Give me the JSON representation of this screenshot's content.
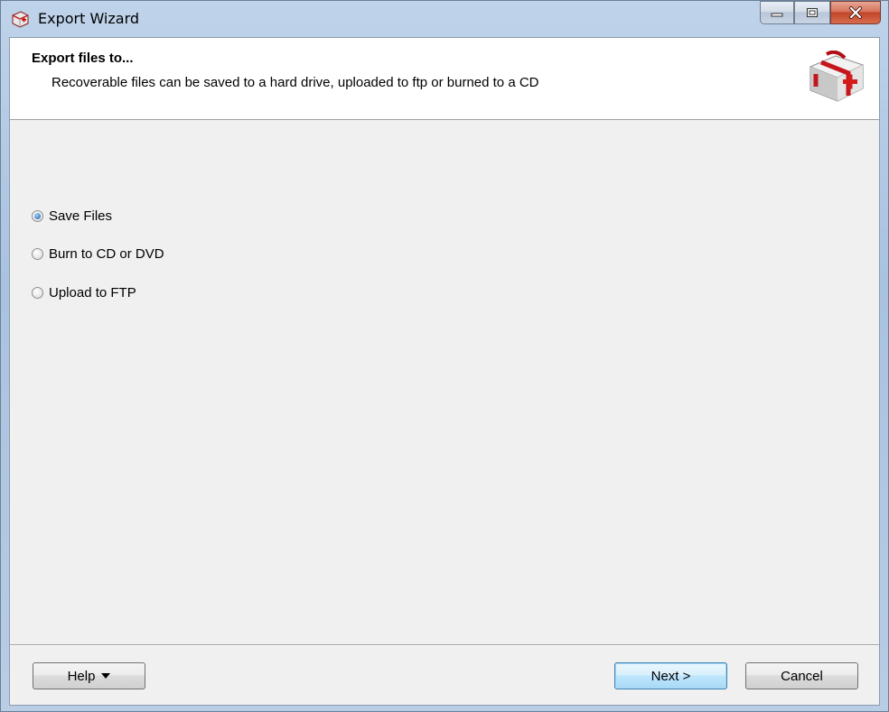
{
  "window": {
    "title": "Export Wizard",
    "icons": {
      "app": "first-aid-kit-icon",
      "minimize": "minimize-icon",
      "maximize": "maximize-icon",
      "close": "close-icon"
    }
  },
  "header": {
    "title": "Export files to...",
    "subtitle": "Recoverable files can be saved to a hard drive, uploaded to ftp or burned to a CD",
    "icon": "first-aid-kit-icon"
  },
  "options": [
    {
      "label": "Save Files",
      "selected": true
    },
    {
      "label": "Burn to CD or DVD",
      "selected": false
    },
    {
      "label": "Upload to FTP",
      "selected": false
    }
  ],
  "buttons": {
    "help": "Help",
    "next": "Next >",
    "cancel": "Cancel"
  },
  "colors": {
    "accent": "#1f5fa8",
    "close_button": "#c2452a",
    "frame": "#a9c2df"
  }
}
